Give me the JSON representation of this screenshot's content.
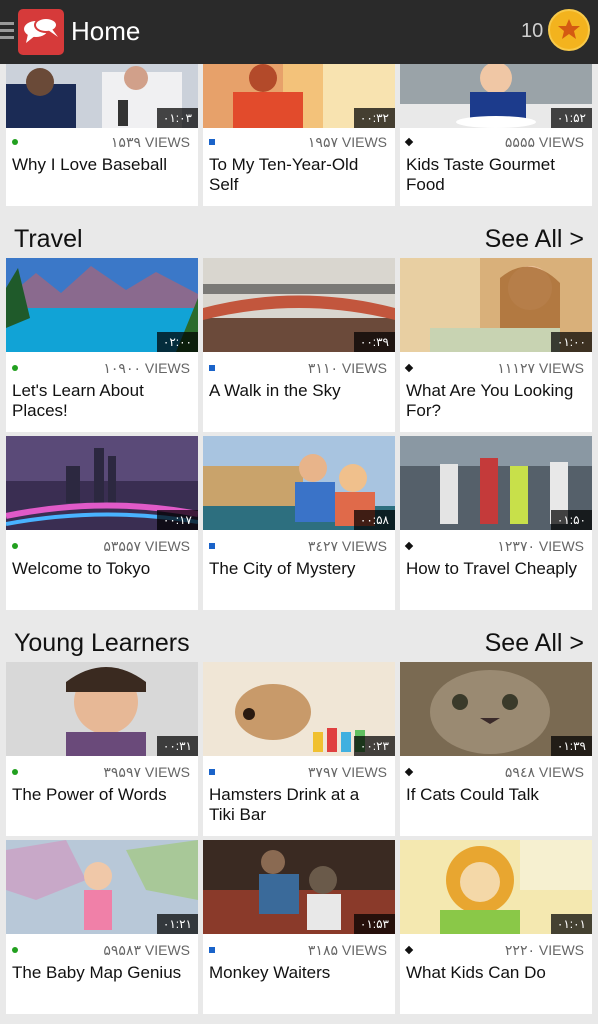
{
  "topbar": {
    "title": "Home",
    "count": "10",
    "menu_icon": "menu-icon",
    "logo_icon": "chat-bubbles-logo",
    "coin_icon": "star-coin-icon"
  },
  "colors": {
    "topbar": "#2a2a2a",
    "dot_green": "#22a01f",
    "dot_blue": "#1a63c9",
    "dot_black": "#111111",
    "coin": "#f3b31e"
  },
  "sections": [
    {
      "title": "",
      "see_all": ""
    },
    {
      "title": "Travel",
      "see_all": "See All >"
    },
    {
      "title": "Young Learners",
      "see_all": "See All >"
    }
  ],
  "videos": [
    {
      "title": "Why I Love Baseball",
      "views": "۱۵۳۹ VIEWS",
      "duration": "۰۱:۰۳",
      "dot": "green"
    },
    {
      "title": "To My Ten-Year-Old Self",
      "views": "۱۹۵۷ VIEWS",
      "duration": "۰۰:۳۲",
      "dot": "blue"
    },
    {
      "title": "Kids Taste Gourmet Food",
      "views": "۵۵۵۵ VIEWS",
      "duration": "۰۱:۵۲",
      "dot": "black"
    },
    {
      "title": "Let's Learn About Places!",
      "views": "۱۰۹۰۰ VIEWS",
      "duration": "۰۲:۰۰",
      "dot": "green"
    },
    {
      "title": "A Walk in the Sky",
      "views": "۳۱۱۰ VIEWS",
      "duration": "۰۰:۳۹",
      "dot": "blue"
    },
    {
      "title": "What Are You Looking For?",
      "views": "۱۱۱۲۷ VIEWS",
      "duration": "۰۱:۰۰",
      "dot": "black"
    },
    {
      "title": "Welcome to Tokyo",
      "views": "۵۳۵۵۷ VIEWS",
      "duration": "۰۰:۱۷",
      "dot": "green"
    },
    {
      "title": "The City of Mystery",
      "views": "۳٤۲۷ VIEWS",
      "duration": "۰۰:۵۸",
      "dot": "blue"
    },
    {
      "title": "How to Travel Cheaply",
      "views": "۱۲۳۷۰ VIEWS",
      "duration": "۰۱:۵۰",
      "dot": "black"
    },
    {
      "title": "The Power of Words",
      "views": "۳۹۵۹۷ VIEWS",
      "duration": "۰۰:۳۱",
      "dot": "green"
    },
    {
      "title": "Hamsters Drink at a Tiki Bar",
      "views": "۳۷۹۷ VIEWS",
      "duration": "۰۰:۲۳",
      "dot": "blue"
    },
    {
      "title": "If Cats Could Talk",
      "views": "۵۹٤۸ VIEWS",
      "duration": "۰۱:۳۹",
      "dot": "black"
    },
    {
      "title": "The Baby Map Genius",
      "views": "۵۹۵۸۳ VIEWS",
      "duration": "۰۱:۲۱",
      "dot": "green"
    },
    {
      "title": "Monkey Waiters",
      "views": "۳۱۸۵ VIEWS",
      "duration": "۰۱:۵۳",
      "dot": "blue"
    },
    {
      "title": "What Kids Can Do",
      "views": "۲۲۲۰ VIEWS",
      "duration": "۰۱:۰۱",
      "dot": "black"
    }
  ]
}
